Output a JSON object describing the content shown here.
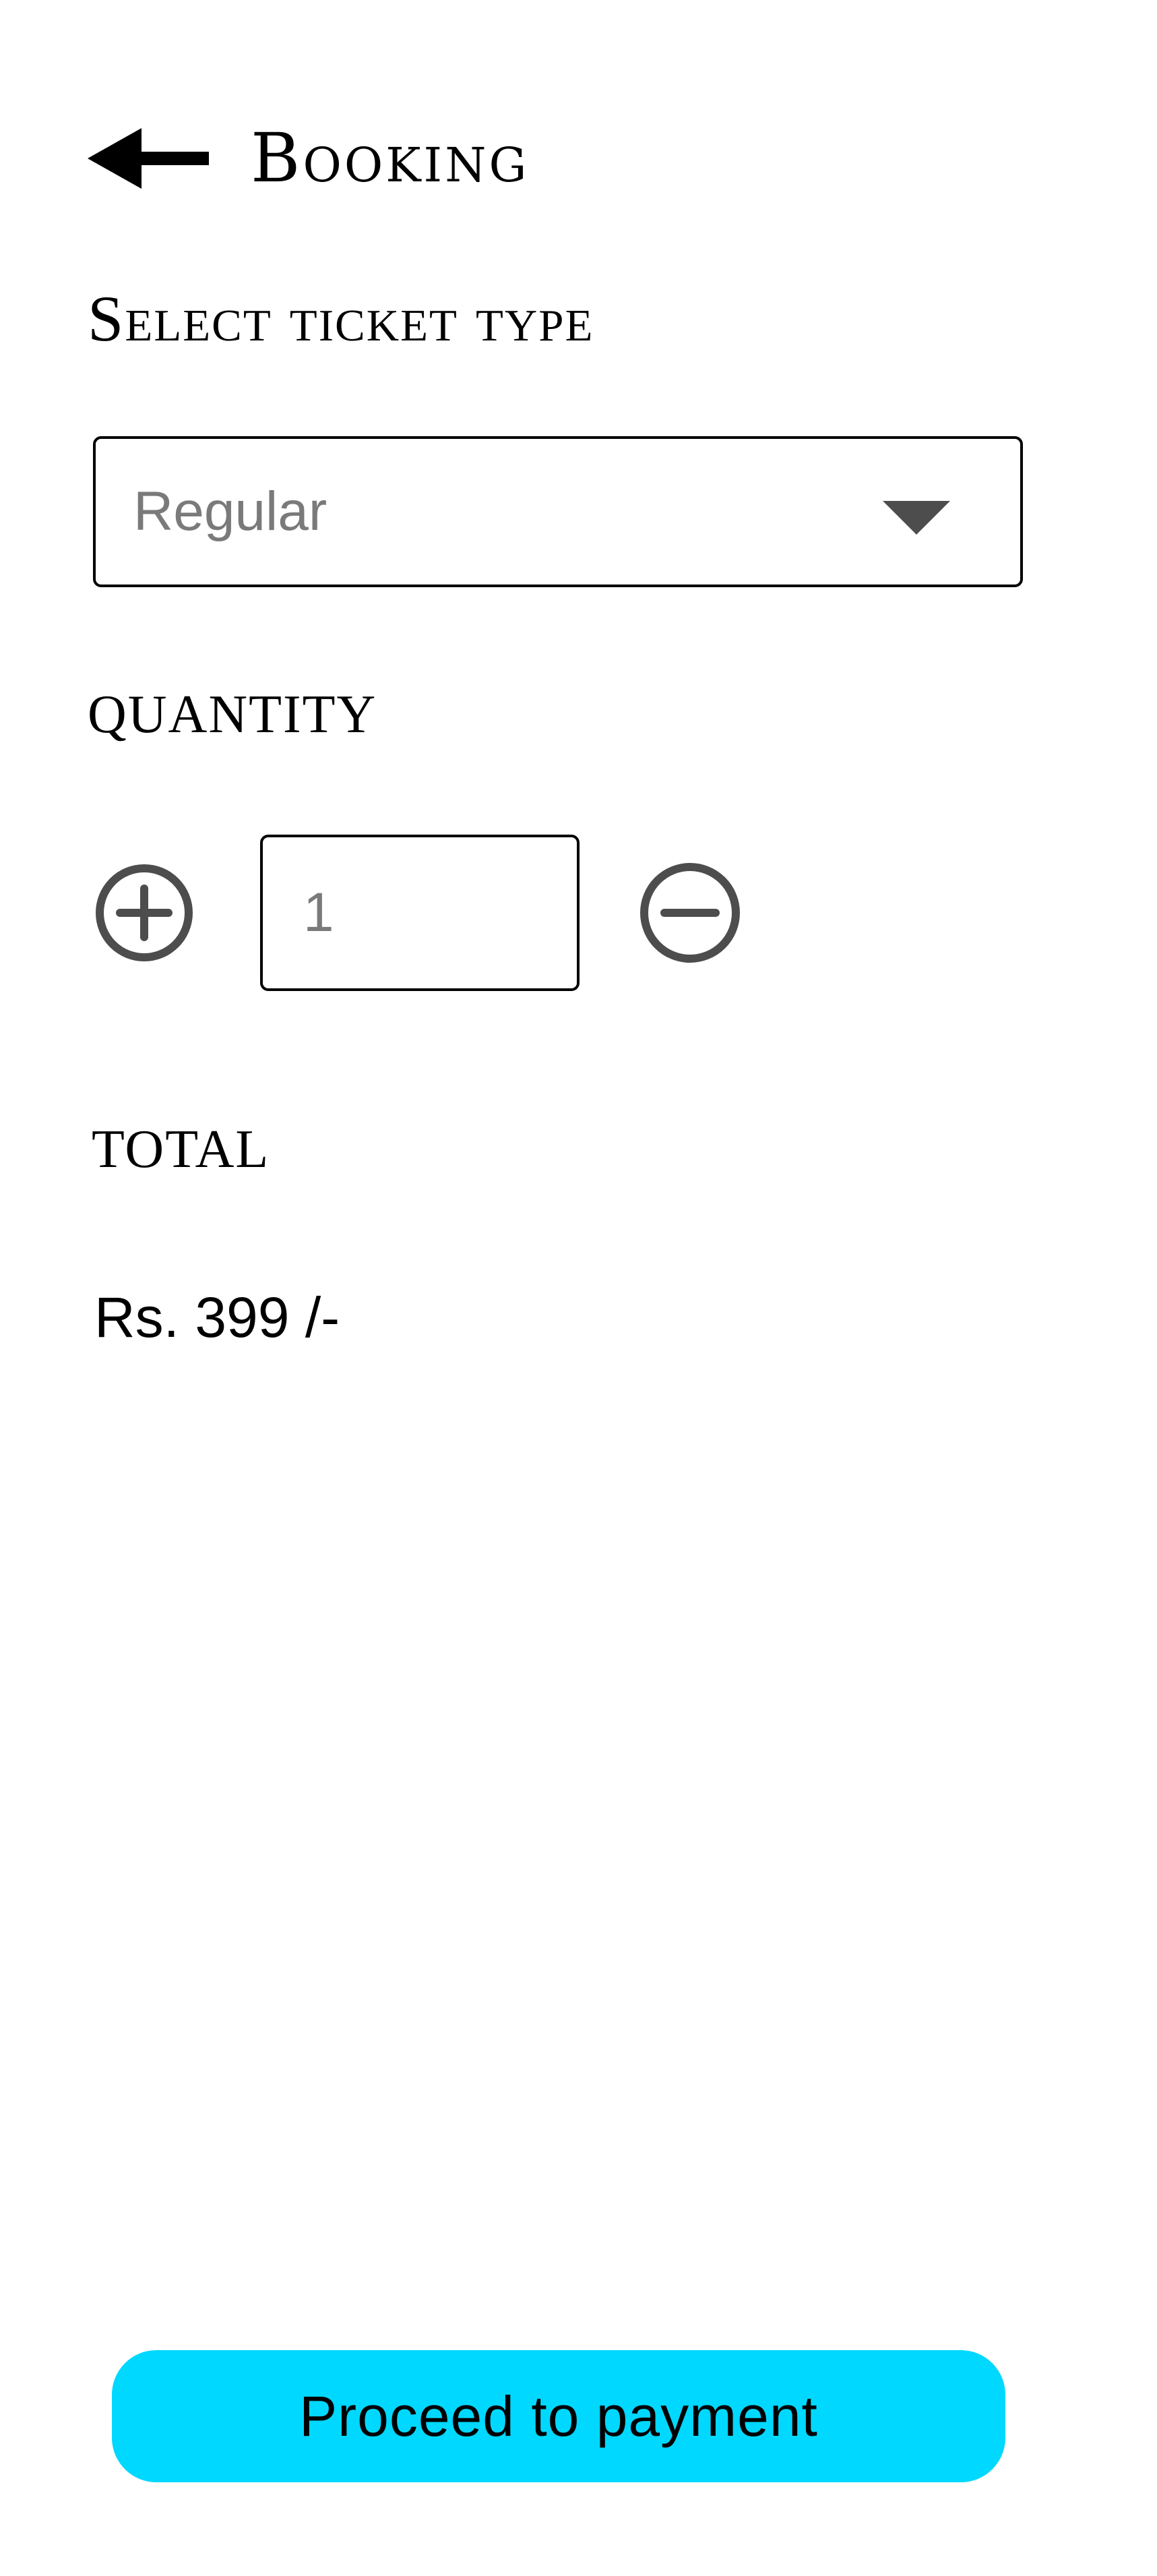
{
  "header": {
    "title": "Booking"
  },
  "ticket_type": {
    "label": "Select ticket type",
    "selected": "Regular"
  },
  "quantity": {
    "label": "QUANTITY",
    "value": "1"
  },
  "total": {
    "label": "TOTAL",
    "amount": "Rs. 399 /-"
  },
  "actions": {
    "proceed_label": "Proceed to payment"
  },
  "icons": {
    "back": "arrow-left-icon",
    "dropdown": "caret-down-icon",
    "increment": "plus-circle-icon",
    "decrement": "minus-circle-icon"
  },
  "colors": {
    "accent": "#00d8ff",
    "icon": "#4d4d4d",
    "placeholder_text": "#7a7a7a"
  }
}
